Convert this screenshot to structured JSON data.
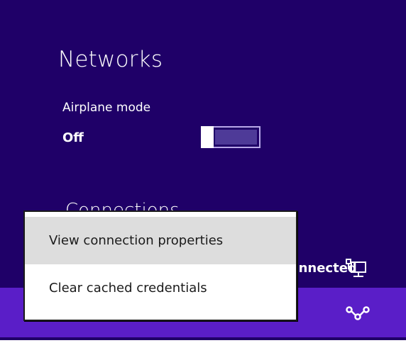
{
  "panel": {
    "title": "Networks",
    "airplane_mode": {
      "label": "Airplane mode",
      "value": "Off",
      "on": false
    },
    "connections_heading": "Connections",
    "network": {
      "status": "Connected",
      "icon": "wired-network-icon"
    },
    "selected_network": {
      "icon": "network-share-icon"
    }
  },
  "context_menu": {
    "items": [
      {
        "label": "View connection properties",
        "hovered": true
      },
      {
        "label": "Clear cached credentials",
        "hovered": false
      }
    ]
  },
  "colors": {
    "panel_bg": "#1f0068",
    "selected_bg": "#5a1ec8",
    "toggle_track": "#4e3a98",
    "menu_hover": "#dddddd"
  }
}
